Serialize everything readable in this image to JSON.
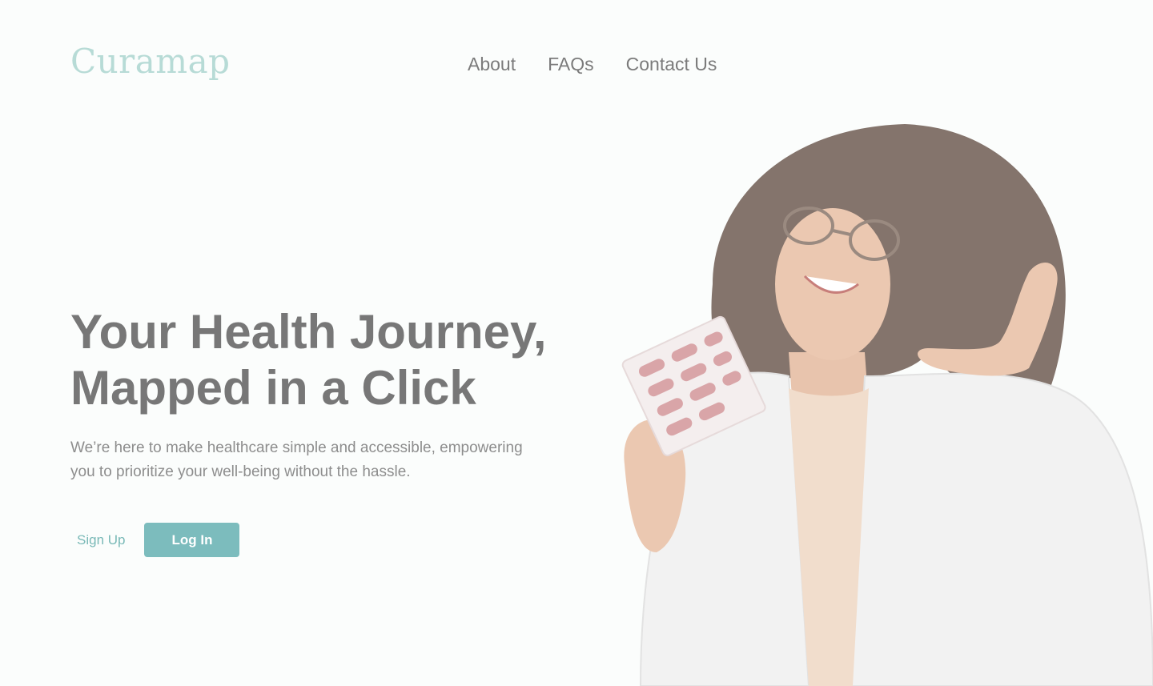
{
  "header": {
    "logo": "Curamap",
    "nav": [
      {
        "label": "About"
      },
      {
        "label": "FAQs"
      },
      {
        "label": "Contact Us"
      }
    ]
  },
  "hero": {
    "title_lines": [
      "Your Health Journey,",
      "Mapped in a Click"
    ],
    "subtitle_lines": [
      "We’re here to make healthcare simple and accessible, empowering",
      "you to prioritize your well-being without the hassle."
    ],
    "signup_label": "Sign Up",
    "login_label": "Log In"
  },
  "icons": {
    "hero_image": "smiling-pharmacist-holding-pill-blister-pack"
  },
  "colors": {
    "background": "#fbfdfc",
    "logo": "#b7dbd6",
    "accent": "#7cbcbd",
    "heading": "#777777",
    "body_text": "#8d8d8d"
  }
}
